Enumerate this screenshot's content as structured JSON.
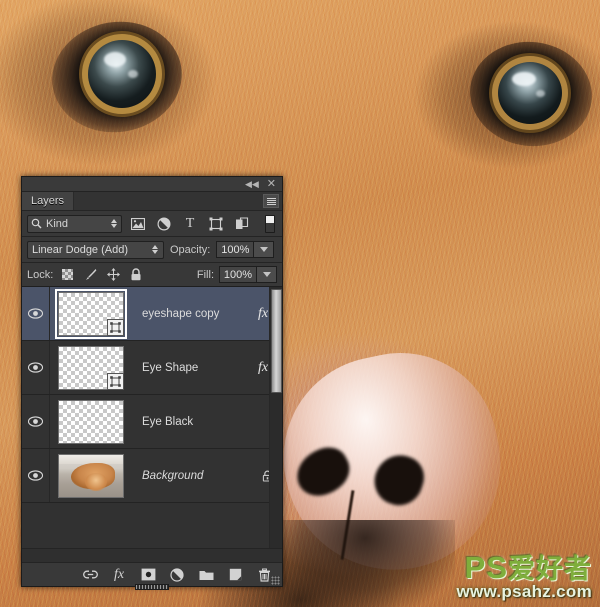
{
  "app": {
    "panel_title": "Layers",
    "titlebar": {
      "collapse_icon": "double-chevron-left-icon",
      "collapse_glyph": "◀◀",
      "close_icon": "close-icon",
      "close_glyph": "✕"
    },
    "panel_menu_icon": "panel-menu-icon"
  },
  "filter_bar": {
    "search_icon": "magnifier-icon",
    "kind_label": "Kind",
    "buttons": [
      {
        "name": "filter-pixel-layers",
        "icon": "image-icon",
        "title": "Pixel Layers"
      },
      {
        "name": "filter-adjustment-layers",
        "icon": "adjustment-circle-icon",
        "title": "Adjustment Layers"
      },
      {
        "name": "filter-type-layers",
        "icon": "type-t-icon",
        "title": "Type Layers",
        "glyph": "T"
      },
      {
        "name": "filter-shape-layers",
        "icon": "shape-square-icon",
        "title": "Shape Layers"
      },
      {
        "name": "filter-smart-objects",
        "icon": "smart-object-icon",
        "title": "Smart Objects"
      }
    ],
    "toggle_name": "filter-enable-toggle"
  },
  "blend_bar": {
    "blend_mode": "Linear Dodge (Add)",
    "opacity_label": "Opacity:",
    "opacity_value": "100%"
  },
  "lock_bar": {
    "lock_label": "Lock:",
    "buttons": [
      {
        "name": "lock-transparent-pixels",
        "icon": "checkerboard-icon"
      },
      {
        "name": "lock-image-pixels",
        "icon": "brush-icon"
      },
      {
        "name": "lock-position",
        "icon": "move-arrows-icon"
      },
      {
        "name": "lock-all",
        "icon": "padlock-icon"
      }
    ],
    "fill_label": "Fill:",
    "fill_value": "100%"
  },
  "layers": [
    {
      "name": "eyeshape copy",
      "selected": true,
      "visible": true,
      "thumb": "transparent",
      "has_fx": true,
      "has_vector_badge": true,
      "italic": false,
      "locked": false
    },
    {
      "name": "Eye Shape",
      "selected": false,
      "visible": true,
      "thumb": "transparent",
      "has_fx": true,
      "has_vector_badge": true,
      "italic": false,
      "locked": false
    },
    {
      "name": "Eye Black",
      "selected": false,
      "visible": true,
      "thumb": "transparent",
      "has_fx": false,
      "has_vector_badge": false,
      "italic": false,
      "locked": false
    },
    {
      "name": "Background",
      "selected": false,
      "visible": true,
      "thumb": "photo",
      "has_fx": false,
      "has_vector_badge": false,
      "italic": true,
      "locked": true
    }
  ],
  "bottom_bar": {
    "buttons": [
      {
        "name": "link-layers-button",
        "icon": "link-chain-icon"
      },
      {
        "name": "layer-style-button",
        "icon": "fx-icon",
        "glyph": "fx"
      },
      {
        "name": "add-layer-mask-button",
        "icon": "layer-mask-icon"
      },
      {
        "name": "new-adjustment-layer-button",
        "icon": "adjustment-half-circle-icon"
      },
      {
        "name": "new-group-button",
        "icon": "folder-icon"
      },
      {
        "name": "new-layer-button",
        "icon": "new-layer-icon"
      },
      {
        "name": "delete-layer-button",
        "icon": "trash-icon"
      }
    ]
  },
  "watermark": {
    "brand": "PS",
    "brand_cn": "爱好者",
    "url": "www.psahz.com"
  },
  "colors": {
    "panel_bg": "#2b2b2b",
    "row_bg": "#323232",
    "selected_row": "#4b5469",
    "text": "#dcdcdc",
    "fur": "#d79a5e",
    "watermark_green": "#7fae3c"
  }
}
